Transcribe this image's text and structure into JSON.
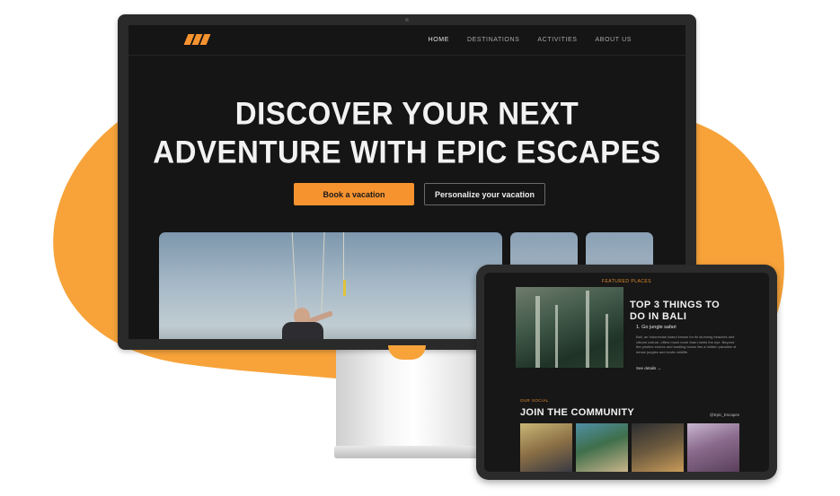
{
  "colors": {
    "accent": "#f7932f",
    "blob": "#f7a33a",
    "screen_bg": "#151515"
  },
  "desktop": {
    "nav": {
      "logo_icon": "brand-stripes-icon",
      "links": [
        {
          "label": "HOME",
          "active": true
        },
        {
          "label": "DESTINATIONS",
          "active": false
        },
        {
          "label": "ACTIVITIES",
          "active": false
        },
        {
          "label": "ABOUT US",
          "active": false
        }
      ]
    },
    "hero": {
      "title_line1": "DISCOVER YOUR NEXT",
      "title_line2": "ADVENTURE WITH EPIC ESCAPES",
      "primary_button": "Book a vacation",
      "secondary_button": "Personalize your vacation"
    }
  },
  "tablet": {
    "featured": {
      "label": "FEATURED PLACES",
      "title_line1": "TOP 3 THINGS TO",
      "title_line2": "DO IN BALI",
      "item": "1. Go jungle safari",
      "description": "Bali, an Indonesian island known for its stunning beaches and vibrant culture, offers much more than meets the eye. Beyond the pristine shores and bustling towns lies a hidden paradise of dense jungles and exotic wildlife.",
      "link": "See details →"
    },
    "social": {
      "label": "OUR SOCIAL",
      "title": "JOIN THE COMMUNITY",
      "handle": "@Epic_Escapes"
    }
  }
}
